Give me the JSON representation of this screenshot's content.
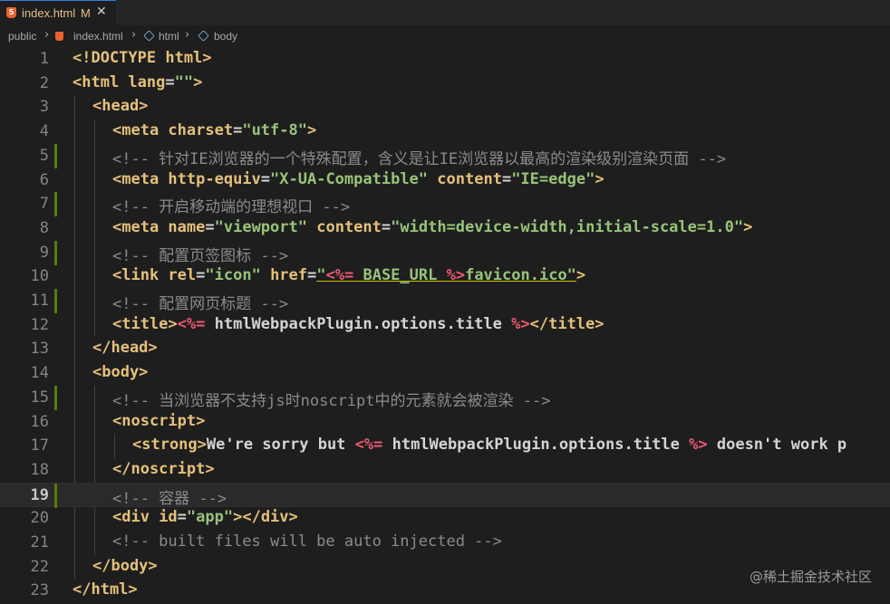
{
  "tab": {
    "filename": "index.html",
    "status": "M",
    "close": "✕",
    "icon": "html5-icon"
  },
  "breadcrumb": {
    "folder": "public",
    "file": "index.html",
    "tag1": "html",
    "tag2": "body",
    "sep": "›"
  },
  "editor": {
    "active_line": 19,
    "lines": [
      {
        "n": "1",
        "indent": 0,
        "gutter": false,
        "tokens": [
          [
            "t",
            "<!DOCTYPE html>"
          ]
        ]
      },
      {
        "n": "2",
        "indent": 0,
        "gutter": false,
        "tokens": [
          [
            "t",
            "<html "
          ],
          [
            "a",
            "lang"
          ],
          [
            "p",
            "="
          ],
          [
            "s",
            "\"\""
          ],
          [
            "t",
            ">"
          ]
        ]
      },
      {
        "n": "3",
        "indent": 1,
        "gutter": false,
        "tokens": [
          [
            "t",
            "<head>"
          ]
        ]
      },
      {
        "n": "4",
        "indent": 2,
        "gutter": false,
        "tokens": [
          [
            "t",
            "<meta "
          ],
          [
            "a",
            "charset"
          ],
          [
            "p",
            "="
          ],
          [
            "s",
            "\"utf-8\""
          ],
          [
            "t",
            ">"
          ]
        ]
      },
      {
        "n": "5",
        "indent": 2,
        "gutter": true,
        "tokens": [
          [
            "c",
            "<!-- 针对IE浏览器的一个特殊配置，含义是让IE浏览器以最高的渲染级别渲染页面 -->"
          ]
        ]
      },
      {
        "n": "6",
        "indent": 2,
        "gutter": false,
        "tokens": [
          [
            "t",
            "<meta "
          ],
          [
            "a",
            "http-equiv"
          ],
          [
            "p",
            "="
          ],
          [
            "s",
            "\"X-UA-Compatible\""
          ],
          [
            "p",
            " "
          ],
          [
            "a",
            "content"
          ],
          [
            "p",
            "="
          ],
          [
            "s",
            "\"IE=edge\""
          ],
          [
            "t",
            ">"
          ]
        ]
      },
      {
        "n": "7",
        "indent": 2,
        "gutter": true,
        "tokens": [
          [
            "c",
            "<!-- 开启移动端的理想视口 -->"
          ]
        ]
      },
      {
        "n": "8",
        "indent": 2,
        "gutter": false,
        "tokens": [
          [
            "t",
            "<meta "
          ],
          [
            "a",
            "name"
          ],
          [
            "p",
            "="
          ],
          [
            "s",
            "\"viewport\""
          ],
          [
            "p",
            " "
          ],
          [
            "a",
            "content"
          ],
          [
            "p",
            "="
          ],
          [
            "s",
            "\"width=device-width,initial-scale=1.0\""
          ],
          [
            "t",
            ">"
          ]
        ]
      },
      {
        "n": "9",
        "indent": 2,
        "gutter": true,
        "tokens": [
          [
            "c",
            "<!-- 配置页签图标 -->"
          ]
        ]
      },
      {
        "n": "10",
        "indent": 2,
        "gutter": false,
        "tokens": [
          [
            "t",
            "<link "
          ],
          [
            "a",
            "rel"
          ],
          [
            "p",
            "="
          ],
          [
            "s",
            "\"icon\""
          ],
          [
            "p",
            " "
          ],
          [
            "a",
            "href"
          ],
          [
            "p",
            "="
          ],
          [
            "s",
            "\""
          ],
          [
            "e",
            "<%="
          ],
          [
            "s",
            " BASE_URL "
          ],
          [
            "e",
            "%>"
          ],
          [
            "s",
            "favicon.ico\""
          ],
          [
            "t",
            ">"
          ]
        ]
      },
      {
        "n": "11",
        "indent": 2,
        "gutter": true,
        "tokens": [
          [
            "c",
            "<!-- 配置网页标题 -->"
          ]
        ]
      },
      {
        "n": "12",
        "indent": 2,
        "gutter": false,
        "tokens": [
          [
            "t",
            "<title>"
          ],
          [
            "e",
            "<%="
          ],
          [
            "tx",
            " htmlWebpackPlugin.options.title "
          ],
          [
            "e",
            "%>"
          ],
          [
            "t",
            "</title>"
          ]
        ]
      },
      {
        "n": "13",
        "indent": 1,
        "gutter": false,
        "tokens": [
          [
            "t",
            "</head>"
          ]
        ]
      },
      {
        "n": "14",
        "indent": 1,
        "gutter": false,
        "tokens": [
          [
            "t",
            "<body>"
          ]
        ]
      },
      {
        "n": "15",
        "indent": 2,
        "gutter": true,
        "tokens": [
          [
            "c",
            "<!-- 当浏览器不支持js时noscript中的元素就会被渲染 -->"
          ]
        ]
      },
      {
        "n": "16",
        "indent": 2,
        "gutter": false,
        "tokens": [
          [
            "t",
            "<noscript>"
          ]
        ]
      },
      {
        "n": "17",
        "indent": 3,
        "gutter": false,
        "tokens": [
          [
            "t",
            "<strong>"
          ],
          [
            "tx",
            "We're sorry but "
          ],
          [
            "e",
            "<%="
          ],
          [
            "tx",
            " htmlWebpackPlugin.options.title "
          ],
          [
            "e",
            "%>"
          ],
          [
            "tx",
            " doesn't work p"
          ]
        ]
      },
      {
        "n": "18",
        "indent": 2,
        "gutter": false,
        "tokens": [
          [
            "t",
            "</noscript>"
          ]
        ]
      },
      {
        "n": "19",
        "indent": 2,
        "gutter": true,
        "tokens": [
          [
            "c",
            "<!-- 容器 -->"
          ]
        ]
      },
      {
        "n": "20",
        "indent": 2,
        "gutter": false,
        "tokens": [
          [
            "t",
            "<div "
          ],
          [
            "a",
            "id"
          ],
          [
            "p",
            "="
          ],
          [
            "s",
            "\"app\""
          ],
          [
            "t",
            "></div>"
          ]
        ]
      },
      {
        "n": "21",
        "indent": 2,
        "gutter": false,
        "tokens": [
          [
            "c",
            "<!-- built files will be auto injected -->"
          ]
        ]
      },
      {
        "n": "22",
        "indent": 1,
        "gutter": false,
        "tokens": [
          [
            "t",
            "</body>"
          ]
        ]
      },
      {
        "n": "23",
        "indent": 0,
        "gutter": false,
        "tokens": [
          [
            "t",
            "</html>"
          ]
        ]
      }
    ]
  },
  "watermark": "@稀土掘金技术社区",
  "colors": {
    "tag": "#e5c07b",
    "string": "#98c379",
    "comment": "#8b8b8b",
    "ejs": "#ef596f",
    "gutter_modified": "#587c0c"
  }
}
